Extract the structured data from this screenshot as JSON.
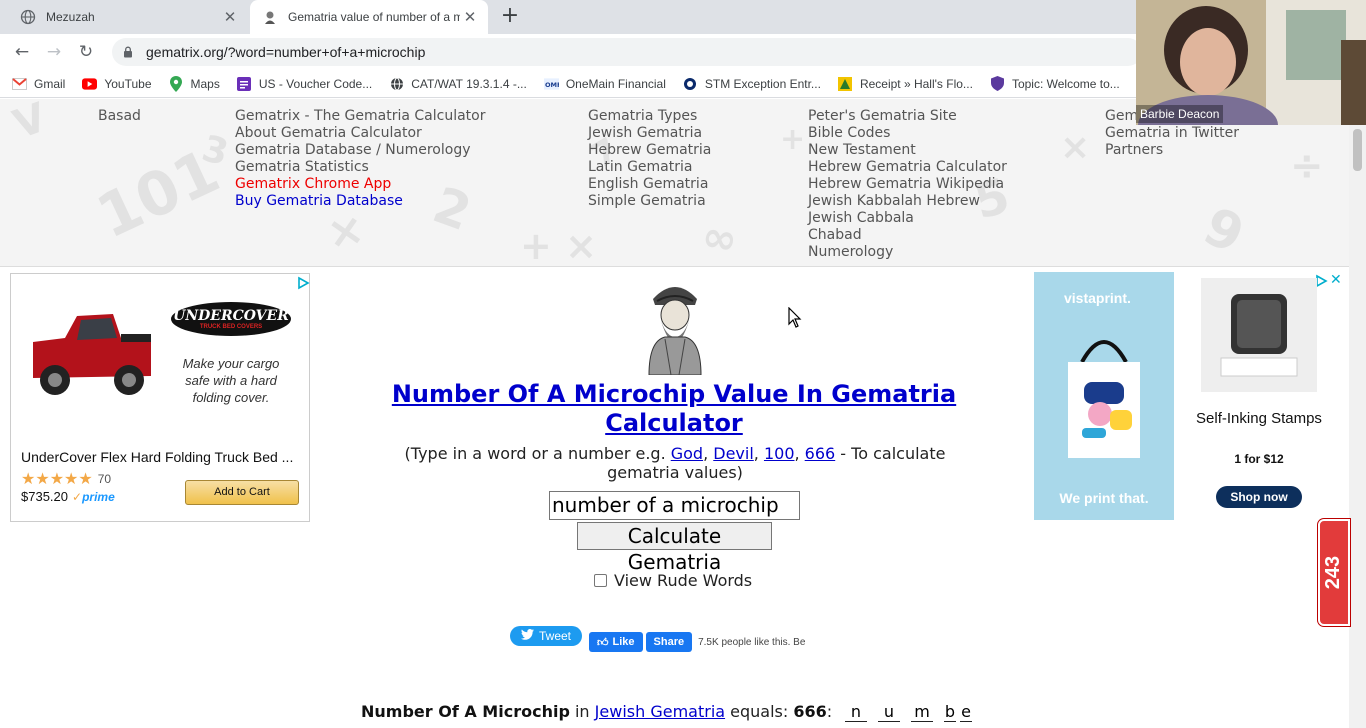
{
  "browser": {
    "tabs": [
      {
        "title": "Mezuzah",
        "active": false
      },
      {
        "title": "Gematria value of number of a m",
        "active": true
      }
    ],
    "url": "gematrix.org/?word=number+of+a+microchip",
    "bookmarks": [
      {
        "label": "Gmail",
        "icon": "gmail-icon"
      },
      {
        "label": "YouTube",
        "icon": "youtube-icon"
      },
      {
        "label": "Maps",
        "icon": "maps-icon"
      },
      {
        "label": "US - Voucher Code...",
        "icon": "voucher-icon"
      },
      {
        "label": "CAT/WAT 19.3.1.4 -...",
        "icon": "globe-icon"
      },
      {
        "label": "OneMain Financial",
        "icon": "onemain-icon"
      },
      {
        "label": "STM Exception Entr...",
        "icon": "stm-icon"
      },
      {
        "label": "Receipt » Hall's Flo...",
        "icon": "receipt-icon"
      },
      {
        "label": "Topic: Welcome to...",
        "icon": "shield-icon"
      }
    ]
  },
  "nav": {
    "col0": [
      "Basad"
    ],
    "col1": [
      "Gematrix - The Gematria Calculator",
      "About Gematria Calculator",
      "Gematria Database / Numerology",
      "Gematria Statistics",
      "Gematrix Chrome App",
      "Buy Gematria Database"
    ],
    "col2": [
      "Gematria Types",
      "Jewish Gematria",
      "Hebrew Gematria",
      "Latin Gematria",
      "English Gematria",
      "Simple Gematria"
    ],
    "col3": [
      "Peter's Gematria Site",
      "Bible Codes",
      "New Testament",
      "Hebrew Gematria Calculator",
      "Hebrew Gematria Wikipedia",
      "Jewish Kabbalah Hebrew",
      "Jewish Cabbala",
      "Chabad",
      "Numerology"
    ],
    "col4": [
      "Gem",
      "Gematria in Twitter",
      "Partners"
    ]
  },
  "ad_left": {
    "brand": "UNDERCOVER",
    "brand_sub": "TRUCK BED COVERS",
    "tagline": "Make your cargo safe with a hard folding cover.",
    "product": "UnderCover Flex Hard Folding Truck Bed ...",
    "rating_count": "70",
    "price": "$735.20",
    "prime": "prime",
    "button": "Add to Cart"
  },
  "ad_right": {
    "brand": "vistaprint.",
    "slogan": "We print that.",
    "product": "Self-Inking Stamps",
    "offer": "1 for $12",
    "button": "Shop now"
  },
  "main": {
    "title": "Number Of A Microchip Value In Gematria Calculator",
    "hint_prefix": "(Type in a word or a number e.g. ",
    "examples": [
      "God",
      "Devil",
      "100",
      "666"
    ],
    "hint_suffix": " - To calculate gematria values)",
    "input_value": "number of a microchip",
    "calc_button": "Calculate Gematria",
    "rude_label": "View Rude Words",
    "tweet": "Tweet",
    "fb_like": "Like",
    "fb_share": "Share",
    "fb_count": "7.5K people like this. Be",
    "result_phrase": "Number Of A Microchip",
    "result_in": "in",
    "result_type": "Jewish Gematria",
    "result_equals": "equals:",
    "result_value": "666",
    "result_colon": ":",
    "letters": [
      "n",
      "u",
      "m",
      "b",
      "e"
    ]
  },
  "counter": "243",
  "webcam": {
    "name": "Barbie Deacon"
  }
}
